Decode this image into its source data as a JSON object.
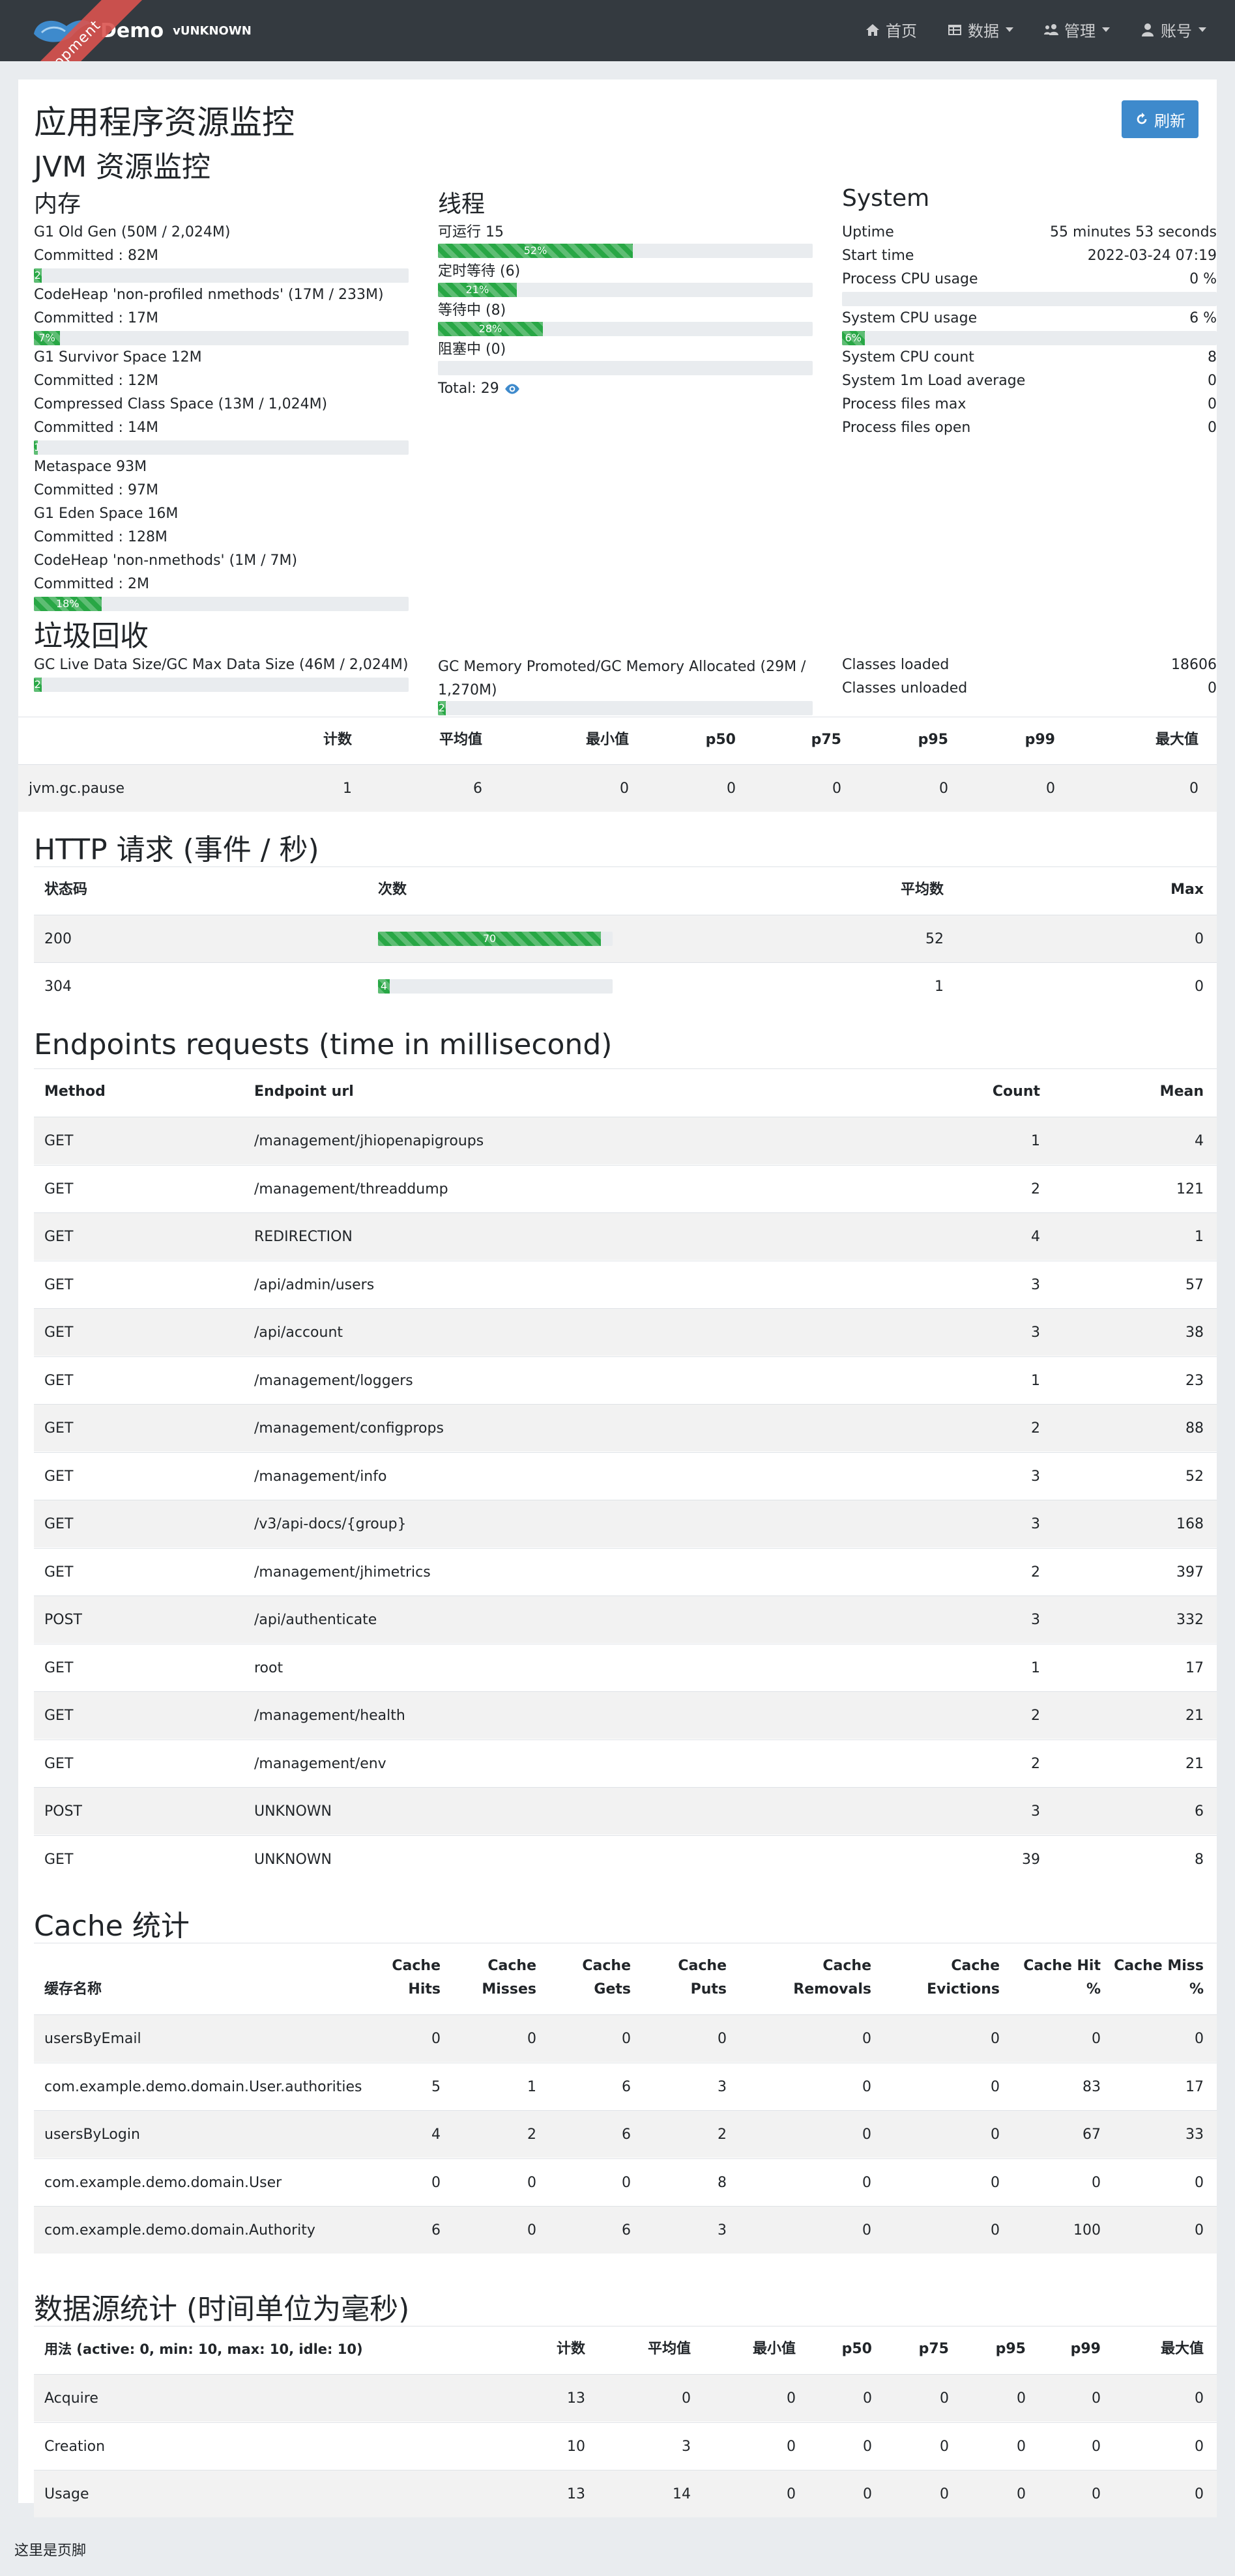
{
  "navbar": {
    "ribbon": "Development",
    "brand_title": "Demo",
    "brand_version": "vUNKNOWN",
    "items": [
      {
        "label": "首页",
        "icon": "home-icon"
      },
      {
        "label": "数据",
        "icon": "table-icon",
        "dropdown": true
      },
      {
        "label": "管理",
        "icon": "users-cog-icon",
        "dropdown": true
      },
      {
        "label": "账号",
        "icon": "user-icon",
        "dropdown": true
      }
    ]
  },
  "page": {
    "title": "应用程序资源监控",
    "refresh_label": "刷新",
    "jvm_title": "JVM 资源监控"
  },
  "memory": {
    "title": "内存",
    "items": [
      {
        "name": "G1 Old Gen (50M / 2,024M)",
        "committed": "Committed : 82M",
        "percent": 2,
        "label": "2"
      },
      {
        "name": "CodeHeap 'non-profiled nmethods' (17M / 233M)",
        "committed": "Committed : 17M",
        "percent": 7,
        "label": "7%"
      },
      {
        "name": "G1 Survivor Space 12M",
        "committed": "Committed : 12M"
      },
      {
        "name": "Compressed Class Space (13M / 1,024M)",
        "committed": "Committed : 14M",
        "percent": 1,
        "label": "1"
      },
      {
        "name": "Metaspace 93M",
        "committed": "Committed : 97M"
      },
      {
        "name": "G1 Eden Space 16M",
        "committed": "Committed : 128M"
      },
      {
        "name": "CodeHeap 'non-nmethods' (1M / 7M)",
        "committed": "Committed : 2M",
        "percent": 18,
        "label": "18%"
      }
    ]
  },
  "threads": {
    "title": "线程",
    "items": [
      {
        "label": "可运行 15",
        "percent": 52,
        "bar_label": "52%"
      },
      {
        "label": "定时等待 (6)",
        "percent": 21,
        "bar_label": "21%"
      },
      {
        "label": "等待中 (8)",
        "percent": 28,
        "bar_label": "28%"
      },
      {
        "label": "阻塞中 (0)",
        "percent": 0,
        "bar_label": ""
      }
    ],
    "total": "Total: 29"
  },
  "system": {
    "title": "System",
    "uptime_label": "Uptime",
    "uptime": "55 minutes 53 seconds",
    "start_label": "Start time",
    "start": "2022-03-24 07:19",
    "process_cpu_label": "Process CPU usage",
    "process_cpu": "0 %",
    "process_cpu_pct": 0,
    "system_cpu_label": "System CPU usage",
    "system_cpu": "6 %",
    "system_cpu_pct": 6,
    "system_cpu_bar": "6%",
    "cpu_count_label": "System CPU count",
    "cpu_count": "8",
    "load_label": "System 1m Load average",
    "load": "0",
    "files_max_label": "Process files max",
    "files_max": "0",
    "files_open_label": "Process files open",
    "files_open": "0"
  },
  "gc": {
    "title": "垃圾回收",
    "live_label": "GC Live Data Size/GC Max Data Size (46M / 2,024M)",
    "live_pct": 2,
    "live_bar": "2",
    "promoted_label": "GC Memory Promoted/GC Memory Allocated (29M / 1,270M)",
    "promoted_pct": 2,
    "promoted_bar": "2",
    "classes_loaded_label": "Classes loaded",
    "classes_loaded": "18606",
    "classes_unloaded_label": "Classes unloaded",
    "classes_unloaded": "0",
    "table": {
      "headers": [
        "计数",
        "平均值",
        "最小值",
        "p50",
        "p75",
        "p95",
        "p99",
        "最大值"
      ],
      "row": {
        "name": "jvm.gc.pause",
        "values": [
          "1",
          "6",
          "0",
          "0",
          "0",
          "0",
          "0",
          "0"
        ]
      }
    }
  },
  "http": {
    "title": "HTTP 请求 (事件 / 秒)",
    "headers": [
      "状态码",
      "次数",
      "平均数",
      "Max"
    ],
    "rows": [
      {
        "code": "200",
        "count": "70",
        "pct": 95,
        "mean": "52",
        "max": "0"
      },
      {
        "code": "304",
        "count": "4",
        "pct": 5,
        "mean": "1",
        "max": "0"
      }
    ]
  },
  "endpoints": {
    "title": "Endpoints requests (time in millisecond)",
    "headers": [
      "Method",
      "Endpoint url",
      "Count",
      "Mean"
    ],
    "rows": [
      [
        "GET",
        "/management/jhiopenapigroups",
        "1",
        "4"
      ],
      [
        "GET",
        "/management/threaddump",
        "2",
        "121"
      ],
      [
        "GET",
        "REDIRECTION",
        "4",
        "1"
      ],
      [
        "GET",
        "/api/admin/users",
        "3",
        "57"
      ],
      [
        "GET",
        "/api/account",
        "3",
        "38"
      ],
      [
        "GET",
        "/management/loggers",
        "1",
        "23"
      ],
      [
        "GET",
        "/management/configprops",
        "2",
        "88"
      ],
      [
        "GET",
        "/management/info",
        "3",
        "52"
      ],
      [
        "GET",
        "/v3/api-docs/{group}",
        "3",
        "168"
      ],
      [
        "GET",
        "/management/jhimetrics",
        "2",
        "397"
      ],
      [
        "POST",
        "/api/authenticate",
        "3",
        "332"
      ],
      [
        "GET",
        "root",
        "1",
        "17"
      ],
      [
        "GET",
        "/management/health",
        "2",
        "21"
      ],
      [
        "GET",
        "/management/env",
        "2",
        "21"
      ],
      [
        "POST",
        "UNKNOWN",
        "3",
        "6"
      ],
      [
        "GET",
        "UNKNOWN",
        "39",
        "8"
      ]
    ]
  },
  "cache": {
    "title": "Cache 统计",
    "headers": [
      {
        "l1": "",
        "l2": "缓存名称"
      },
      {
        "l1": "Cache",
        "l2": "Hits"
      },
      {
        "l1": "Cache",
        "l2": "Misses"
      },
      {
        "l1": "Cache",
        "l2": "Gets"
      },
      {
        "l1": "Cache",
        "l2": "Puts"
      },
      {
        "l1": "Cache",
        "l2": "Removals"
      },
      {
        "l1": "Cache",
        "l2": "Evictions"
      },
      {
        "l1": "Cache Hit",
        "l2": "%"
      },
      {
        "l1": "Cache Miss",
        "l2": "%"
      }
    ],
    "rows": [
      [
        "usersByEmail",
        "0",
        "0",
        "0",
        "0",
        "0",
        "0",
        "0",
        "0"
      ],
      [
        "com.example.demo.domain.User.authorities",
        "5",
        "1",
        "6",
        "3",
        "0",
        "0",
        "83",
        "17"
      ],
      [
        "usersByLogin",
        "4",
        "2",
        "6",
        "2",
        "0",
        "0",
        "67",
        "33"
      ],
      [
        "com.example.demo.domain.User",
        "0",
        "0",
        "0",
        "8",
        "0",
        "0",
        "0",
        "0"
      ],
      [
        "com.example.demo.domain.Authority",
        "6",
        "0",
        "6",
        "3",
        "0",
        "0",
        "100",
        "0"
      ]
    ]
  },
  "datasource": {
    "title": "数据源统计 (时间单位为毫秒)",
    "headers": [
      "用法 (active: 0, min: 10, max: 10, idle: 10)",
      "计数",
      "平均值",
      "最小值",
      "p50",
      "p75",
      "p95",
      "p99",
      "最大值"
    ],
    "rows": [
      [
        "Acquire",
        "13",
        "0",
        "0",
        "0",
        "0",
        "0",
        "0",
        "0"
      ],
      [
        "Creation",
        "10",
        "3",
        "0",
        "0",
        "0",
        "0",
        "0",
        "0"
      ],
      [
        "Usage",
        "13",
        "14",
        "0",
        "0",
        "0",
        "0",
        "0",
        "0"
      ]
    ]
  },
  "footer": {
    "text": "这里是页脚"
  }
}
